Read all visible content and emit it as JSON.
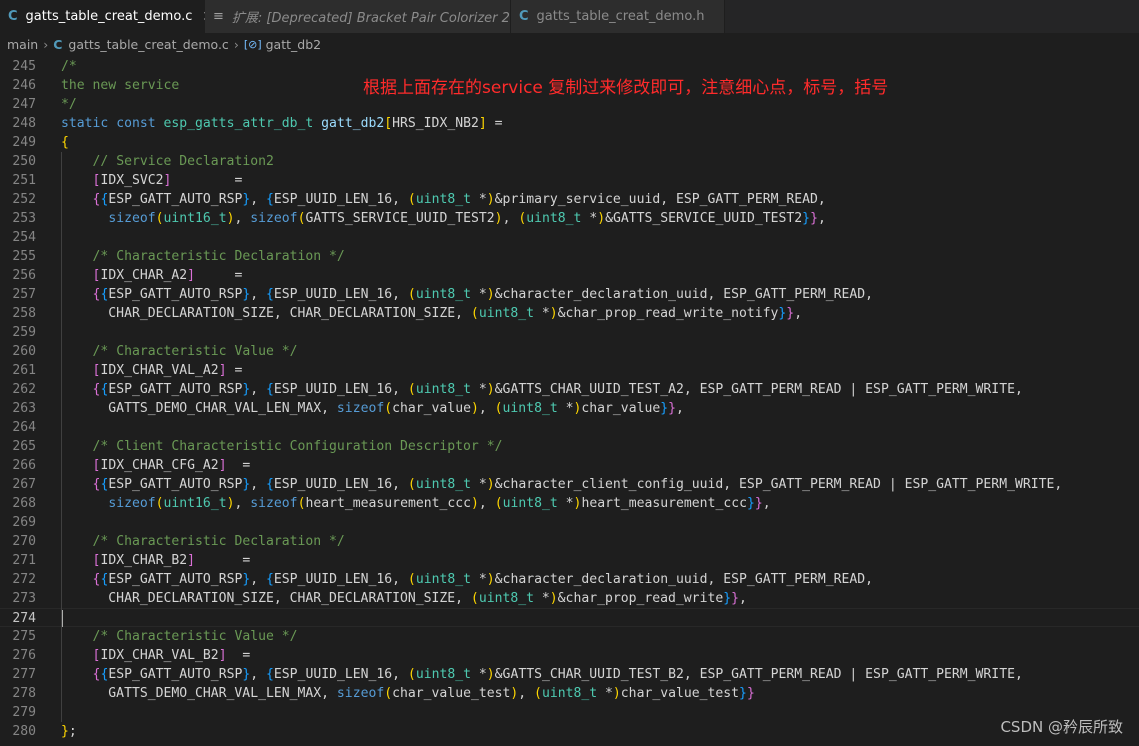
{
  "tabs": [
    {
      "icon": "C",
      "label": "gatts_table_creat_demo.c",
      "active": true,
      "close": "✕"
    },
    {
      "icon": "≡",
      "label": "扩展: [Deprecated] Bracket Pair Colorizer 2",
      "active": false
    },
    {
      "icon": "C",
      "label": "gatts_table_creat_demo.h",
      "active": false
    }
  ],
  "breadcrumb": {
    "branch": "main",
    "sep": "›",
    "file": "gatts_table_creat_demo.c",
    "file_icon": "C",
    "symbol_icon": "[⊘]",
    "symbol": "gatt_db2"
  },
  "annotation": "根据上面存在的service 复制过来修改即可，注意细心点，标号，括号",
  "watermark": "CSDN @矜辰所致",
  "current_line": 274,
  "lines": [
    {
      "n": "245",
      "t": [
        [
          "c-com",
          "/*"
        ]
      ]
    },
    {
      "n": "246",
      "t": [
        [
          "c-com",
          "the new service"
        ]
      ]
    },
    {
      "n": "247",
      "t": [
        [
          "c-com",
          "*/"
        ]
      ]
    },
    {
      "n": "248",
      "t": [
        [
          "c-kw",
          "static "
        ],
        [
          "c-kw",
          "const "
        ],
        [
          "c-type",
          "esp_gatts_attr_db_t "
        ],
        [
          "c-var",
          "gatt_db2"
        ],
        [
          "c-b1",
          "["
        ],
        [
          "c-pl",
          "HRS_IDX_NB2"
        ],
        [
          "c-b1",
          "]"
        ],
        [
          "c-pl",
          " ="
        ]
      ]
    },
    {
      "n": "249",
      "t": [
        [
          "c-b1",
          "{"
        ]
      ]
    },
    {
      "n": "250",
      "t": [
        [
          "c-pl",
          "    "
        ],
        [
          "c-com",
          "// Service Declaration2"
        ]
      ]
    },
    {
      "n": "251",
      "t": [
        [
          "c-pl",
          "    "
        ],
        [
          "c-b2",
          "["
        ],
        [
          "c-pl",
          "IDX_SVC2"
        ],
        [
          "c-b2",
          "]"
        ],
        [
          "c-pl",
          "        ="
        ]
      ]
    },
    {
      "n": "252",
      "t": [
        [
          "c-pl",
          "    "
        ],
        [
          "c-b2",
          "{"
        ],
        [
          "c-b3",
          "{"
        ],
        [
          "c-pl",
          "ESP_GATT_AUTO_RSP"
        ],
        [
          "c-b3",
          "}"
        ],
        [
          "c-pl",
          ", "
        ],
        [
          "c-b3",
          "{"
        ],
        [
          "c-pl",
          "ESP_UUID_LEN_16, "
        ],
        [
          "c-b1",
          "("
        ],
        [
          "c-type",
          "uint8_t "
        ],
        [
          "c-pl",
          "*"
        ],
        [
          "c-b1",
          ")"
        ],
        [
          "c-pl",
          "&primary_service_uuid, ESP_GATT_PERM_READ,"
        ]
      ]
    },
    {
      "n": "253",
      "t": [
        [
          "c-pl",
          "      "
        ],
        [
          "c-kw",
          "sizeof"
        ],
        [
          "c-b1",
          "("
        ],
        [
          "c-type",
          "uint16_t"
        ],
        [
          "c-b1",
          ")"
        ],
        [
          "c-pl",
          ", "
        ],
        [
          "c-kw",
          "sizeof"
        ],
        [
          "c-b1",
          "("
        ],
        [
          "c-pl",
          "GATTS_SERVICE_UUID_TEST2"
        ],
        [
          "c-b1",
          ")"
        ],
        [
          "c-pl",
          ", "
        ],
        [
          "c-b1",
          "("
        ],
        [
          "c-type",
          "uint8_t "
        ],
        [
          "c-pl",
          "*"
        ],
        [
          "c-b1",
          ")"
        ],
        [
          "c-pl",
          "&GATTS_SERVICE_UUID_TEST2"
        ],
        [
          "c-b3",
          "}"
        ],
        [
          "c-b2",
          "}"
        ],
        [
          "c-pl",
          ","
        ]
      ]
    },
    {
      "n": "254",
      "t": []
    },
    {
      "n": "255",
      "t": [
        [
          "c-pl",
          "    "
        ],
        [
          "c-com",
          "/* Characteristic Declaration */"
        ]
      ]
    },
    {
      "n": "256",
      "t": [
        [
          "c-pl",
          "    "
        ],
        [
          "c-b2",
          "["
        ],
        [
          "c-pl",
          "IDX_CHAR_A2"
        ],
        [
          "c-b2",
          "]"
        ],
        [
          "c-pl",
          "     ="
        ]
      ]
    },
    {
      "n": "257",
      "t": [
        [
          "c-pl",
          "    "
        ],
        [
          "c-b2",
          "{"
        ],
        [
          "c-b3",
          "{"
        ],
        [
          "c-pl",
          "ESP_GATT_AUTO_RSP"
        ],
        [
          "c-b3",
          "}"
        ],
        [
          "c-pl",
          ", "
        ],
        [
          "c-b3",
          "{"
        ],
        [
          "c-pl",
          "ESP_UUID_LEN_16, "
        ],
        [
          "c-b1",
          "("
        ],
        [
          "c-type",
          "uint8_t "
        ],
        [
          "c-pl",
          "*"
        ],
        [
          "c-b1",
          ")"
        ],
        [
          "c-pl",
          "&character_declaration_uuid, ESP_GATT_PERM_READ,"
        ]
      ]
    },
    {
      "n": "258",
      "t": [
        [
          "c-pl",
          "      CHAR_DECLARATION_SIZE, CHAR_DECLARATION_SIZE, "
        ],
        [
          "c-b1",
          "("
        ],
        [
          "c-type",
          "uint8_t "
        ],
        [
          "c-pl",
          "*"
        ],
        [
          "c-b1",
          ")"
        ],
        [
          "c-pl",
          "&char_prop_read_write_notify"
        ],
        [
          "c-b3",
          "}"
        ],
        [
          "c-b2",
          "}"
        ],
        [
          "c-pl",
          ","
        ]
      ]
    },
    {
      "n": "259",
      "t": []
    },
    {
      "n": "260",
      "t": [
        [
          "c-pl",
          "    "
        ],
        [
          "c-com",
          "/* Characteristic Value */"
        ]
      ]
    },
    {
      "n": "261",
      "t": [
        [
          "c-pl",
          "    "
        ],
        [
          "c-b2",
          "["
        ],
        [
          "c-pl",
          "IDX_CHAR_VAL_A2"
        ],
        [
          "c-b2",
          "]"
        ],
        [
          "c-pl",
          " ="
        ]
      ]
    },
    {
      "n": "262",
      "t": [
        [
          "c-pl",
          "    "
        ],
        [
          "c-b2",
          "{"
        ],
        [
          "c-b3",
          "{"
        ],
        [
          "c-pl",
          "ESP_GATT_AUTO_RSP"
        ],
        [
          "c-b3",
          "}"
        ],
        [
          "c-pl",
          ", "
        ],
        [
          "c-b3",
          "{"
        ],
        [
          "c-pl",
          "ESP_UUID_LEN_16, "
        ],
        [
          "c-b1",
          "("
        ],
        [
          "c-type",
          "uint8_t "
        ],
        [
          "c-pl",
          "*"
        ],
        [
          "c-b1",
          ")"
        ],
        [
          "c-pl",
          "&GATTS_CHAR_UUID_TEST_A2, ESP_GATT_PERM_READ | ESP_GATT_PERM_WRITE,"
        ]
      ]
    },
    {
      "n": "263",
      "t": [
        [
          "c-pl",
          "      GATTS_DEMO_CHAR_VAL_LEN_MAX, "
        ],
        [
          "c-kw",
          "sizeof"
        ],
        [
          "c-b1",
          "("
        ],
        [
          "c-pl",
          "char_value"
        ],
        [
          "c-b1",
          ")"
        ],
        [
          "c-pl",
          ", "
        ],
        [
          "c-b1",
          "("
        ],
        [
          "c-type",
          "uint8_t "
        ],
        [
          "c-pl",
          "*"
        ],
        [
          "c-b1",
          ")"
        ],
        [
          "c-pl",
          "char_value"
        ],
        [
          "c-b3",
          "}"
        ],
        [
          "c-b2",
          "}"
        ],
        [
          "c-pl",
          ","
        ]
      ]
    },
    {
      "n": "264",
      "t": []
    },
    {
      "n": "265",
      "t": [
        [
          "c-pl",
          "    "
        ],
        [
          "c-com",
          "/* Client Characteristic Configuration Descriptor */"
        ]
      ]
    },
    {
      "n": "266",
      "t": [
        [
          "c-pl",
          "    "
        ],
        [
          "c-b2",
          "["
        ],
        [
          "c-pl",
          "IDX_CHAR_CFG_A2"
        ],
        [
          "c-b2",
          "]"
        ],
        [
          "c-pl",
          "  ="
        ]
      ]
    },
    {
      "n": "267",
      "t": [
        [
          "c-pl",
          "    "
        ],
        [
          "c-b2",
          "{"
        ],
        [
          "c-b3",
          "{"
        ],
        [
          "c-pl",
          "ESP_GATT_AUTO_RSP"
        ],
        [
          "c-b3",
          "}"
        ],
        [
          "c-pl",
          ", "
        ],
        [
          "c-b3",
          "{"
        ],
        [
          "c-pl",
          "ESP_UUID_LEN_16, "
        ],
        [
          "c-b1",
          "("
        ],
        [
          "c-type",
          "uint8_t "
        ],
        [
          "c-pl",
          "*"
        ],
        [
          "c-b1",
          ")"
        ],
        [
          "c-pl",
          "&character_client_config_uuid, ESP_GATT_PERM_READ | ESP_GATT_PERM_WRITE,"
        ]
      ]
    },
    {
      "n": "268",
      "t": [
        [
          "c-pl",
          "      "
        ],
        [
          "c-kw",
          "sizeof"
        ],
        [
          "c-b1",
          "("
        ],
        [
          "c-type",
          "uint16_t"
        ],
        [
          "c-b1",
          ")"
        ],
        [
          "c-pl",
          ", "
        ],
        [
          "c-kw",
          "sizeof"
        ],
        [
          "c-b1",
          "("
        ],
        [
          "c-pl",
          "heart_measurement_ccc"
        ],
        [
          "c-b1",
          ")"
        ],
        [
          "c-pl",
          ", "
        ],
        [
          "c-b1",
          "("
        ],
        [
          "c-type",
          "uint8_t "
        ],
        [
          "c-pl",
          "*"
        ],
        [
          "c-b1",
          ")"
        ],
        [
          "c-pl",
          "heart_measurement_ccc"
        ],
        [
          "c-b3",
          "}"
        ],
        [
          "c-b2",
          "}"
        ],
        [
          "c-pl",
          ","
        ]
      ]
    },
    {
      "n": "269",
      "t": []
    },
    {
      "n": "270",
      "t": [
        [
          "c-pl",
          "    "
        ],
        [
          "c-com",
          "/* Characteristic Declaration */"
        ]
      ]
    },
    {
      "n": "271",
      "t": [
        [
          "c-pl",
          "    "
        ],
        [
          "c-b2",
          "["
        ],
        [
          "c-pl",
          "IDX_CHAR_B2"
        ],
        [
          "c-b2",
          "]"
        ],
        [
          "c-pl",
          "      ="
        ]
      ]
    },
    {
      "n": "272",
      "t": [
        [
          "c-pl",
          "    "
        ],
        [
          "c-b2",
          "{"
        ],
        [
          "c-b3",
          "{"
        ],
        [
          "c-pl",
          "ESP_GATT_AUTO_RSP"
        ],
        [
          "c-b3",
          "}"
        ],
        [
          "c-pl",
          ", "
        ],
        [
          "c-b3",
          "{"
        ],
        [
          "c-pl",
          "ESP_UUID_LEN_16, "
        ],
        [
          "c-b1",
          "("
        ],
        [
          "c-type",
          "uint8_t "
        ],
        [
          "c-pl",
          "*"
        ],
        [
          "c-b1",
          ")"
        ],
        [
          "c-pl",
          "&character_declaration_uuid, ESP_GATT_PERM_READ,"
        ]
      ]
    },
    {
      "n": "273",
      "t": [
        [
          "c-pl",
          "      CHAR_DECLARATION_SIZE, CHAR_DECLARATION_SIZE, "
        ],
        [
          "c-b1",
          "("
        ],
        [
          "c-type",
          "uint8_t "
        ],
        [
          "c-pl",
          "*"
        ],
        [
          "c-b1",
          ")"
        ],
        [
          "c-pl",
          "&char_prop_read_write"
        ],
        [
          "c-b3",
          "}"
        ],
        [
          "c-b2",
          "}"
        ],
        [
          "c-pl",
          ","
        ]
      ]
    },
    {
      "n": "274",
      "t": []
    },
    {
      "n": "275",
      "t": [
        [
          "c-pl",
          "    "
        ],
        [
          "c-com",
          "/* Characteristic Value */"
        ]
      ]
    },
    {
      "n": "276",
      "t": [
        [
          "c-pl",
          "    "
        ],
        [
          "c-b2",
          "["
        ],
        [
          "c-pl",
          "IDX_CHAR_VAL_B2"
        ],
        [
          "c-b2",
          "]"
        ],
        [
          "c-pl",
          "  ="
        ]
      ]
    },
    {
      "n": "277",
      "t": [
        [
          "c-pl",
          "    "
        ],
        [
          "c-b2",
          "{"
        ],
        [
          "c-b3",
          "{"
        ],
        [
          "c-pl",
          "ESP_GATT_AUTO_RSP"
        ],
        [
          "c-b3",
          "}"
        ],
        [
          "c-pl",
          ", "
        ],
        [
          "c-b3",
          "{"
        ],
        [
          "c-pl",
          "ESP_UUID_LEN_16, "
        ],
        [
          "c-b1",
          "("
        ],
        [
          "c-type",
          "uint8_t "
        ],
        [
          "c-pl",
          "*"
        ],
        [
          "c-b1",
          ")"
        ],
        [
          "c-pl",
          "&GATTS_CHAR_UUID_TEST_B2, ESP_GATT_PERM_READ | ESP_GATT_PERM_WRITE,"
        ]
      ]
    },
    {
      "n": "278",
      "t": [
        [
          "c-pl",
          "      GATTS_DEMO_CHAR_VAL_LEN_MAX, "
        ],
        [
          "c-kw",
          "sizeof"
        ],
        [
          "c-b1",
          "("
        ],
        [
          "c-pl",
          "char_value_test"
        ],
        [
          "c-b1",
          ")"
        ],
        [
          "c-pl",
          ", "
        ],
        [
          "c-b1",
          "("
        ],
        [
          "c-type",
          "uint8_t "
        ],
        [
          "c-pl",
          "*"
        ],
        [
          "c-b1",
          ")"
        ],
        [
          "c-pl",
          "char_value_test"
        ],
        [
          "c-b3",
          "}"
        ],
        [
          "c-b2",
          "}"
        ]
      ]
    },
    {
      "n": "279",
      "t": []
    },
    {
      "n": "280",
      "t": [
        [
          "c-b1",
          "}"
        ],
        [
          "c-pl",
          ";"
        ]
      ]
    }
  ]
}
